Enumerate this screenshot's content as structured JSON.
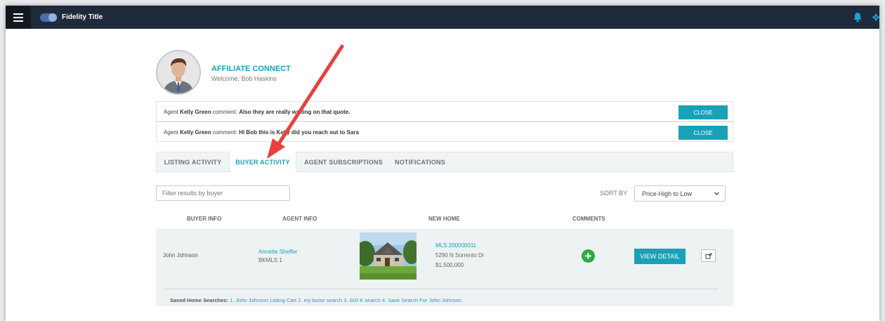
{
  "topbar": {
    "brand": "Fidelity Title"
  },
  "profile": {
    "title": "AFFILIATE CONNECT",
    "welcome": "Welcome, Bob Haskins"
  },
  "notices": [
    {
      "prefix": "Agent",
      "agent": "Kelly Green",
      "mid": "comment:",
      "message": "Also they are really waiting on that quote.",
      "button": "CLOSE"
    },
    {
      "prefix": "Agent",
      "agent": "Kelly Green",
      "mid": "comment:",
      "message": "Hi Bob this is Kelly did you reach out to Sara",
      "button": "CLOSE"
    }
  ],
  "tabs": [
    "LISTING ACTIVITY",
    "BUYER ACTIVITY",
    "AGENT SUBSCRIPTIONS",
    "NOTIFICATIONS"
  ],
  "active_tab": "BUYER ACTIVITY",
  "filter": {
    "placeholder": "Filter results by buyer"
  },
  "sort": {
    "label": "SORT BY",
    "selected": "Price-High to Low"
  },
  "columns": [
    "BUYER INFO",
    "AGENT INFO",
    "NEW HOME",
    "COMMENTS"
  ],
  "rows": [
    {
      "buyer": "John Johnson",
      "agent": "Annette Sheffer",
      "agent_org": "BKMLS 1",
      "mls": "MLS 200000011",
      "address": "5290 N Sorrento Dr",
      "price": "$1,500,000",
      "action": "VIEW DETAIL",
      "saved_label": "Saved Home Searches:",
      "saved_searches": [
        "1. John Johnson Listing Cart",
        "2. my boise search",
        "3. 600 K search",
        "4. Save Search For John Johnson"
      ]
    }
  ],
  "colors": {
    "topbar": "#1f2a3a",
    "accent": "#17a2b8",
    "plus": "#2eaa44",
    "arrow": "#e8403f"
  },
  "icons": [
    "menu-icon",
    "toggle-icon",
    "bell-icon",
    "gear-icon",
    "plus-circle-icon",
    "share-icon",
    "chevron-down-icon",
    "annotation-arrow"
  ]
}
